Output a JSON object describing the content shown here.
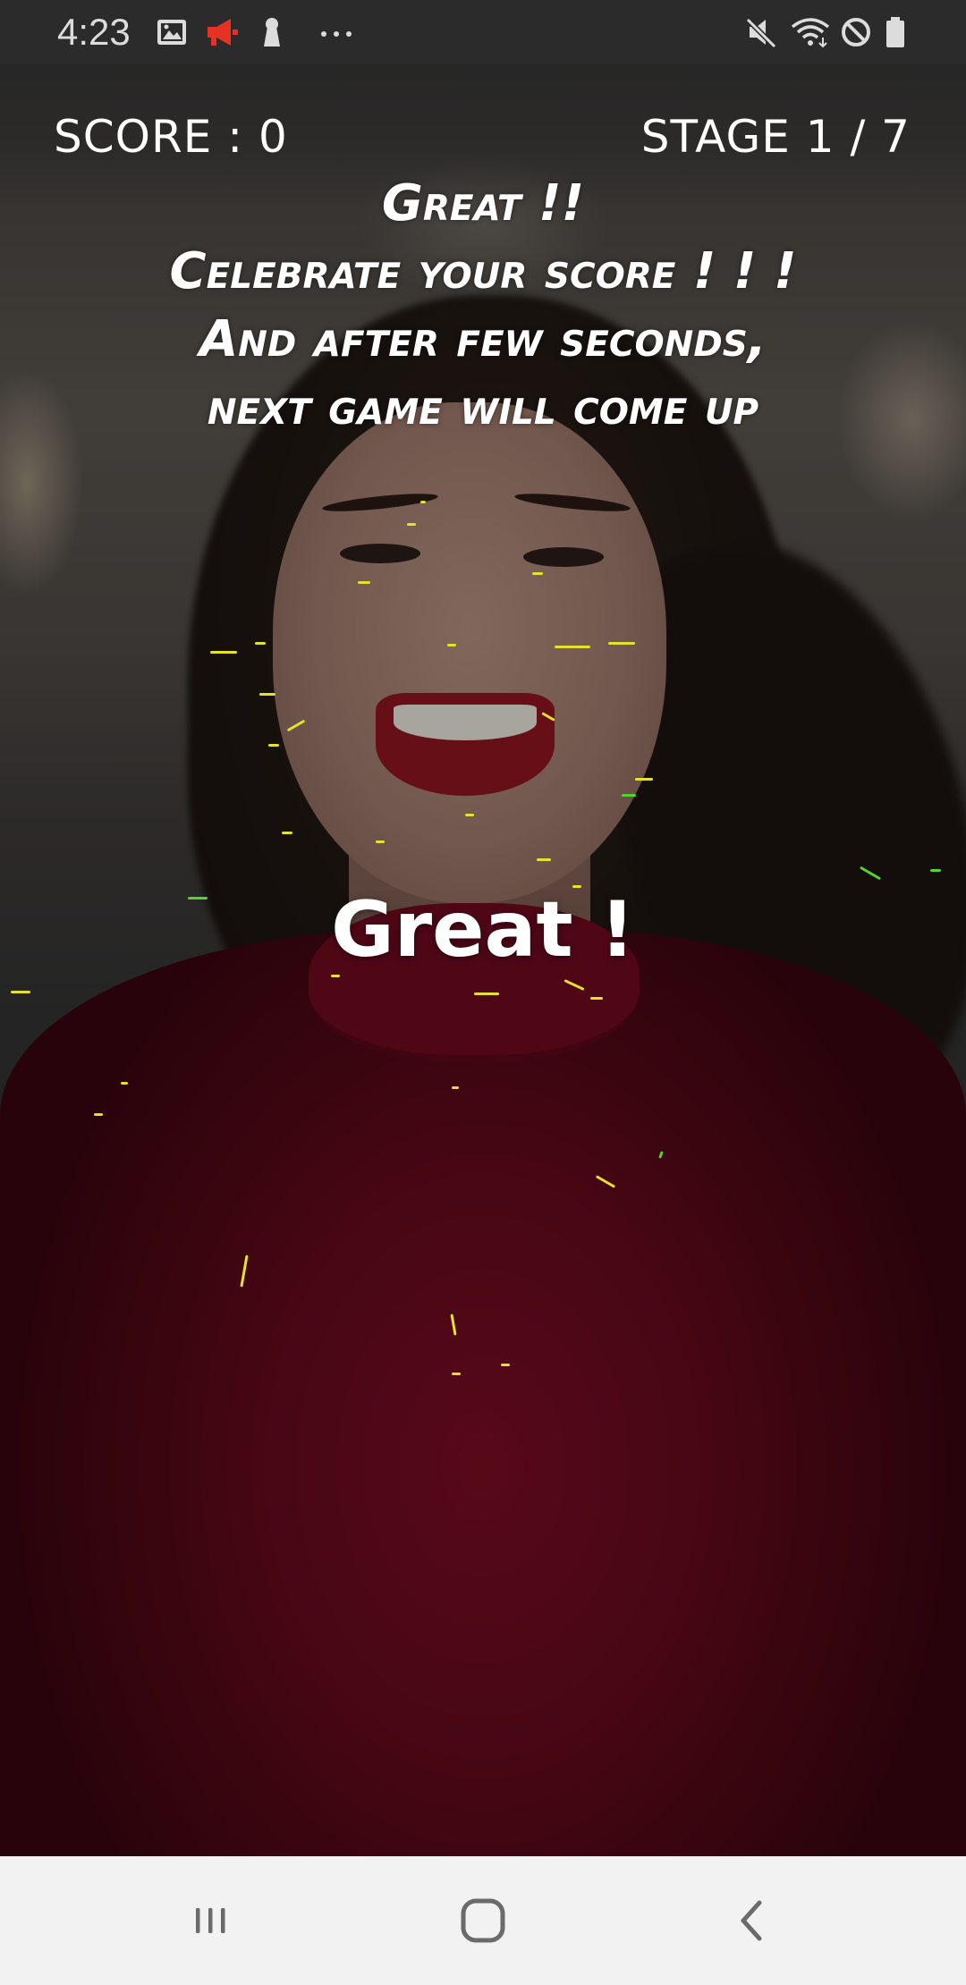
{
  "status_bar": {
    "time": "4:23",
    "left_icons": [
      "image-icon",
      "megaphone-icon",
      "keyhole-icon",
      "more-dots-icon"
    ],
    "right_icons": [
      "mute-icon",
      "wifi-icon",
      "do-not-disturb-icon",
      "battery-icon"
    ],
    "colors": {
      "megaphone": "#e53222",
      "text": "#dcdcdc",
      "background": "#2b2b2b"
    }
  },
  "game": {
    "score_label": "SCORE : 0",
    "stage_label": "STAGE 1 / 7",
    "message_lines": [
      "Great !!",
      "Celebrate your score ! ! !",
      "And after few seconds,",
      "next game will come up"
    ],
    "feedback": "Great !"
  },
  "nav_bar": {
    "buttons": [
      "recent-apps-icon",
      "home-icon",
      "back-icon"
    ],
    "background": "#f2f2f2",
    "icon_color": "#6b6b6b"
  }
}
